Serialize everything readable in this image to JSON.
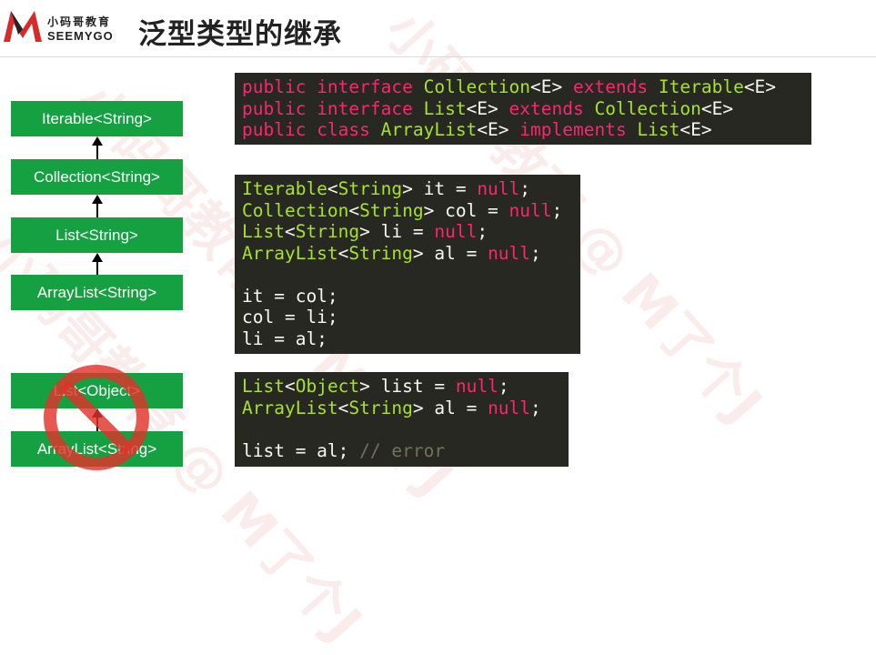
{
  "header": {
    "logo_cn": "小码哥教育",
    "logo_en": "SEEMYGO",
    "title": "泛型类型的继承"
  },
  "hierarchy": {
    "valid": [
      "Iterable<String>",
      "Collection<String>",
      "List<String>",
      "ArrayList<String>"
    ],
    "invalid": [
      "List<Object>",
      "ArrayList<String>"
    ]
  },
  "code_blocks": [
    [
      [
        [
          "kw",
          "public "
        ],
        [
          "kw",
          "interface "
        ],
        [
          "ty",
          "Collection"
        ],
        [
          "pl",
          "<E> "
        ],
        [
          "kw",
          "extends "
        ],
        [
          "ty",
          "Iterable"
        ],
        [
          "pl",
          "<E>"
        ]
      ],
      [
        [
          "kw",
          "public "
        ],
        [
          "kw",
          "interface "
        ],
        [
          "ty",
          "List"
        ],
        [
          "pl",
          "<E> "
        ],
        [
          "kw",
          "extends "
        ],
        [
          "ty",
          "Collection"
        ],
        [
          "pl",
          "<E>"
        ]
      ],
      [
        [
          "kw",
          "public "
        ],
        [
          "kw",
          "class "
        ],
        [
          "ty",
          "ArrayList"
        ],
        [
          "pl",
          "<E> "
        ],
        [
          "kw",
          "implements "
        ],
        [
          "ty",
          "List"
        ],
        [
          "pl",
          "<E>"
        ]
      ]
    ],
    [
      [
        [
          "ty",
          "Iterable"
        ],
        [
          "pl",
          "<"
        ],
        [
          "ty",
          "String"
        ],
        [
          "pl",
          "> it = "
        ],
        [
          "kw",
          "null"
        ],
        [
          "pl",
          ";"
        ]
      ],
      [
        [
          "ty",
          "Collection"
        ],
        [
          "pl",
          "<"
        ],
        [
          "ty",
          "String"
        ],
        [
          "pl",
          "> col = "
        ],
        [
          "kw",
          "null"
        ],
        [
          "pl",
          ";"
        ]
      ],
      [
        [
          "ty",
          "List"
        ],
        [
          "pl",
          "<"
        ],
        [
          "ty",
          "String"
        ],
        [
          "pl",
          "> li = "
        ],
        [
          "kw",
          "null"
        ],
        [
          "pl",
          ";"
        ]
      ],
      [
        [
          "ty",
          "ArrayList"
        ],
        [
          "pl",
          "<"
        ],
        [
          "ty",
          "String"
        ],
        [
          "pl",
          "> al = "
        ],
        [
          "kw",
          "null"
        ],
        [
          "pl",
          ";"
        ]
      ],
      [],
      [
        [
          "pl",
          "it = col;"
        ]
      ],
      [
        [
          "pl",
          "col = li;"
        ]
      ],
      [
        [
          "pl",
          "li = al;"
        ]
      ]
    ],
    [
      [
        [
          "ty",
          "List"
        ],
        [
          "pl",
          "<"
        ],
        [
          "ty",
          "Object"
        ],
        [
          "pl",
          "> list = "
        ],
        [
          "kw",
          "null"
        ],
        [
          "pl",
          ";"
        ]
      ],
      [
        [
          "ty",
          "ArrayList"
        ],
        [
          "pl",
          "<"
        ],
        [
          "ty",
          "String"
        ],
        [
          "pl",
          "> al = "
        ],
        [
          "kw",
          "null"
        ],
        [
          "pl",
          ";"
        ]
      ],
      [],
      [
        [
          "pl",
          "list = al; "
        ],
        [
          "cm",
          "// error"
        ]
      ]
    ]
  ],
  "colors": {
    "box_green": "#15a041",
    "code_bg": "#272822",
    "keyword": "#f92672",
    "type": "#a6e22e",
    "comment": "#75715e",
    "prohibition_red": "#e0332b"
  },
  "watermark": {
    "texts": [
      "小码哥教育 @ M了个J",
      "小码哥教育 @ M了个J",
      "小码哥教育 @ M了个J"
    ]
  }
}
